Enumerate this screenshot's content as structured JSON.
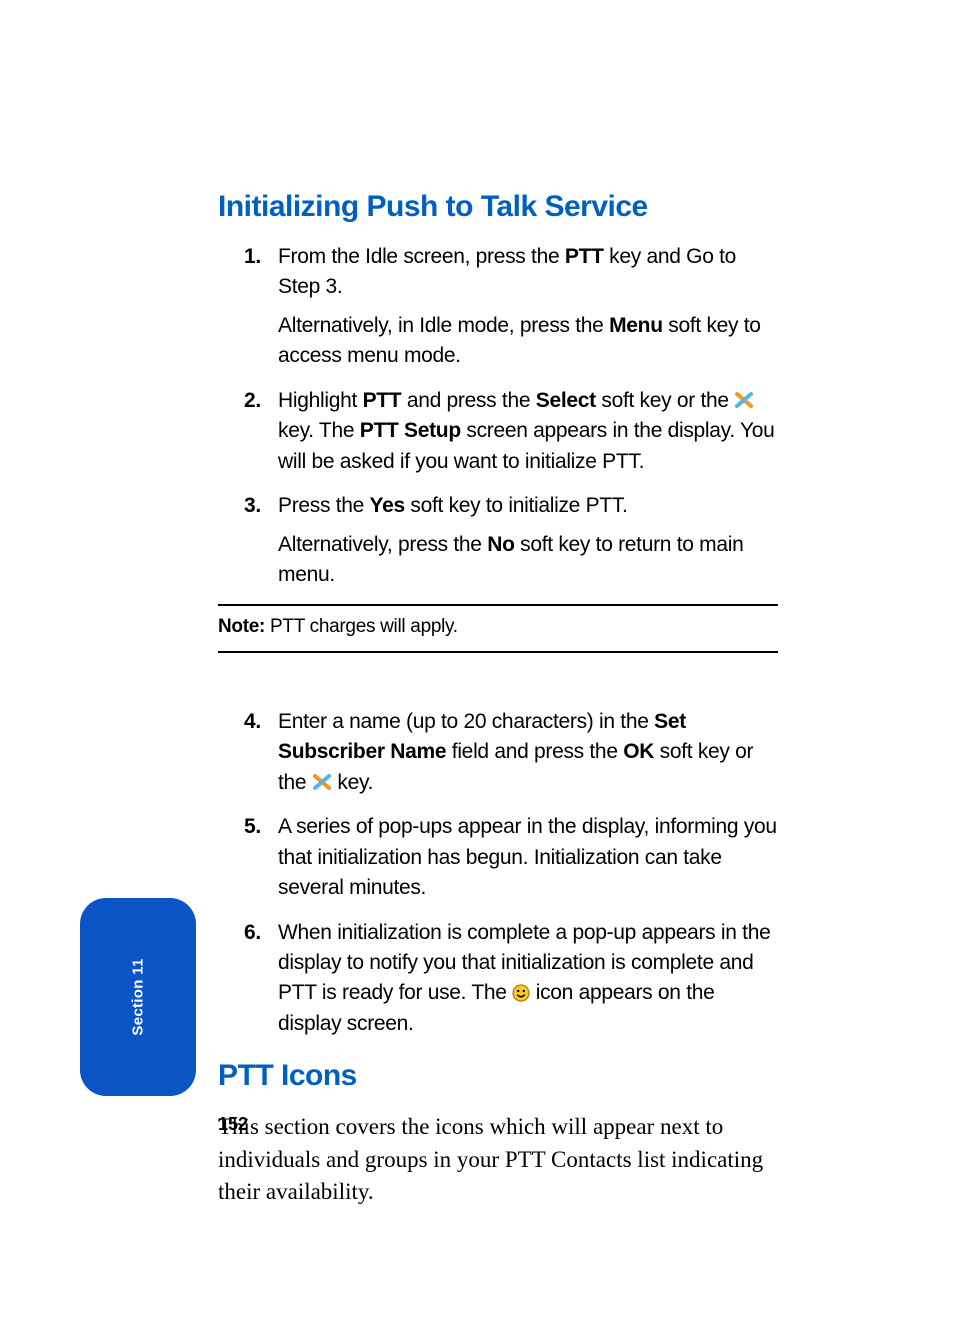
{
  "heading1": "Initializing Push to Talk Service",
  "steps": {
    "s1": {
      "num": "1.",
      "text_a": "From the Idle screen, press the ",
      "b1": "PTT",
      "text_b": " key and Go to Step 3.",
      "alt_a": "Alternatively, in Idle mode, press the ",
      "b2": "Menu",
      "alt_b": " soft key to access menu mode."
    },
    "s2": {
      "num": "2.",
      "t1": "Highlight ",
      "b1": "PTT",
      "t2": " and press the ",
      "b2": "Select",
      "t3": " soft key or the ",
      "t4": " key. The ",
      "b3": "PTT Setup",
      "t5": " screen appears in the display. You will be asked if you want to initialize PTT."
    },
    "s3": {
      "num": "3.",
      "t1": "Press the ",
      "b1": "Yes",
      "t2": " soft key to initialize PTT.",
      "alt_a": "Alternatively, press the ",
      "b2": "No",
      "alt_b": " soft key to return to main menu."
    },
    "s4": {
      "num": "4.",
      "t1": "Enter a name (up to 20 characters) in the ",
      "b1": "Set Subscriber Name",
      "t2": " field and press the ",
      "b2": "OK",
      "t3": " soft key or the ",
      "t4": " key."
    },
    "s5": {
      "num": "5.",
      "t1": "A series of pop-ups appear in the display, informing you that initialization has begun. Initialization can take several minutes."
    },
    "s6": {
      "num": "6.",
      "t1": "When initialization is complete a pop-up appears in the display to notify you that initialization is complete and PTT is ready for use. The ",
      "t2": " icon appears on the display screen."
    }
  },
  "note": {
    "label": "Note:",
    "text": " PTT charges will apply."
  },
  "heading2": "PTT Icons",
  "body": "This section covers the icons which will appear next to individuals and groups in your PTT Contacts list indicating their availability.",
  "page_number": "152",
  "side_tab": "Section 11",
  "icons": {
    "x_primary": "#f7941d",
    "x_secondary": "#4fb7e8",
    "smile_fill": "#f9c92a",
    "smile_stroke": "#b07a00"
  }
}
